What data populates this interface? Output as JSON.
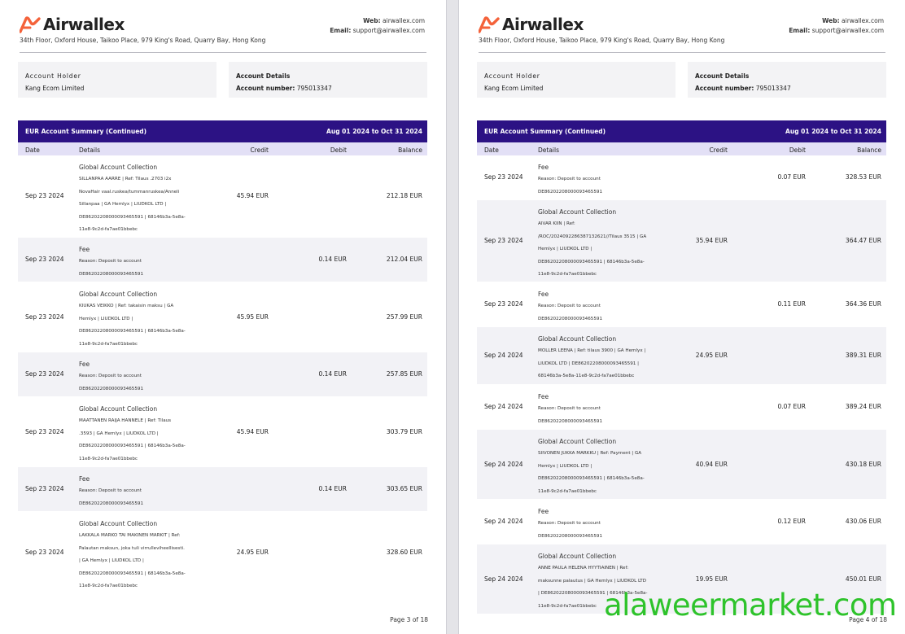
{
  "brand": {
    "name": "Airwallex",
    "address": "34th Floor, Oxford House, Taikoo Place, 979 King's Road, Quarry Bay, Hong Kong",
    "web_label": "Web:",
    "web_value": "airwallex.com",
    "email_label": "Email:",
    "email_value": "support@airwallex.com",
    "accent_color": "#f4623a",
    "header_color": "#2c1284"
  },
  "account": {
    "holder_label": "Account Holder",
    "holder_value": "Kang Ecom Limited",
    "details_label": "Account Details",
    "number_label": "Account number:",
    "number_value": "795013347"
  },
  "summary": {
    "title": "EUR Account Summary (Continued)",
    "period": "Aug 01 2024 to Oct 31 2024",
    "columns": {
      "date": "Date",
      "details": "Details",
      "credit": "Credit",
      "debit": "Debit",
      "balance": "Balance"
    }
  },
  "pages": [
    {
      "page_label": "Page 3 of 18",
      "rows": [
        {
          "date": "Sep 23 2024",
          "title": "Global Account Collection",
          "lines": [
            "SILLANPAA AARRE | Ref: Tilaus .2703 i2x",
            "NovaHair vaal.ruskea/tummanruskea/Anneli",
            "Sillanpaa | GA Hemlyx | LIUDKOL LTD |",
            "DE86202208000093465591 | 68146b3a-5e8a-",
            "11e8-9c2d-fa7ae01bbebc"
          ],
          "credit": "45.94 EUR",
          "debit": "",
          "balance": "212.18 EUR"
        },
        {
          "date": "Sep 23 2024",
          "title": "Fee",
          "lines": [
            "Reason: Deposit to account",
            "DE86202208000093465591"
          ],
          "credit": "",
          "debit": "0.14 EUR",
          "balance": "212.04 EUR"
        },
        {
          "date": "Sep 23 2024",
          "title": "Global Account Collection",
          "lines": [
            "KIUKAS VEIKKO | Ref: takaisin maksu | GA",
            "Hemlyx | LIUDKOL LTD |",
            "DE86202208000093465591 | 68146b3a-5e8a-",
            "11e8-9c2d-fa7ae01bbebc"
          ],
          "credit": "45.95 EUR",
          "debit": "",
          "balance": "257.99 EUR"
        },
        {
          "date": "Sep 23 2024",
          "title": "Fee",
          "lines": [
            "Reason: Deposit to account",
            "DE86202208000093465591"
          ],
          "credit": "",
          "debit": "0.14 EUR",
          "balance": "257.85 EUR"
        },
        {
          "date": "Sep 23 2024",
          "title": "Global Account Collection",
          "lines": [
            "MAATTANEN RAIJA HANNELE | Ref: Tilaus",
            ".3593 | GA Hemlyx | LIUDKOL LTD |",
            "DE86202208000093465591 | 68146b3a-5e8a-",
            "11e8-9c2d-fa7ae01bbebc"
          ],
          "credit": "45.94 EUR",
          "debit": "",
          "balance": "303.79 EUR"
        },
        {
          "date": "Sep 23 2024",
          "title": "Fee",
          "lines": [
            "Reason: Deposit to account",
            "DE86202208000093465591"
          ],
          "credit": "",
          "debit": "0.14 EUR",
          "balance": "303.65 EUR"
        },
        {
          "date": "Sep 23 2024",
          "title": "Global Account Collection",
          "lines": [
            "LAKKALA MARKO TAI MAKINEN MARKIT | Ref:",
            "Palautan maksun, joka tuli virrulleviheellisesti.",
            "| GA Hemlyx | LIUDKOL LTD |",
            "DE86202208000093465591 | 68146b3a-5e8a-",
            "11e8-9c2d-fa7ae01bbebc"
          ],
          "credit": "24.95 EUR",
          "debit": "",
          "balance": "328.60 EUR"
        }
      ]
    },
    {
      "page_label": "Page 4 of 18",
      "rows": [
        {
          "date": "Sep 23 2024",
          "title": "Fee",
          "lines": [
            "Reason: Deposit to account",
            "DE86202208000093465591"
          ],
          "credit": "",
          "debit": "0.07 EUR",
          "balance": "328.53 EUR"
        },
        {
          "date": "Sep 23 2024",
          "title": "Global Account Collection",
          "lines": [
            "AIVAR KIIN | Ref:",
            "/ROC/2024092286387132621//Tilaus 3515 | GA",
            "Hemlyx | LIUDKOL LTD |",
            "DE86202208000093465591 | 68146b3a-5e8a-",
            "11e8-9c2d-fa7ae01bbebc"
          ],
          "credit": "35.94 EUR",
          "debit": "",
          "balance": "364.47 EUR"
        },
        {
          "date": "Sep 23 2024",
          "title": "Fee",
          "lines": [
            "Reason: Deposit to account",
            "DE86202208000093465591"
          ],
          "credit": "",
          "debit": "0.11 EUR",
          "balance": "364.36 EUR"
        },
        {
          "date": "Sep 24 2024",
          "title": "Global Account Collection",
          "lines": [
            "MOLLER LEENA | Ref: tilaus 3900 | GA Hemlyx |",
            "LIUDKOL LTD | DE86202208000093465591 |",
            "68146b3a-5e8a-11e8-9c2d-fa7ae01bbebc"
          ],
          "credit": "24.95 EUR",
          "debit": "",
          "balance": "389.31 EUR"
        },
        {
          "date": "Sep 24 2024",
          "title": "Fee",
          "lines": [
            "Reason: Deposit to account",
            "DE86202208000093465591"
          ],
          "credit": "",
          "debit": "0.07 EUR",
          "balance": "389.24 EUR"
        },
        {
          "date": "Sep 24 2024",
          "title": "Global Account Collection",
          "lines": [
            "SIIVONEN JUKKA MARKKU | Ref: Payment | GA",
            "Hemlyx | LIUDKOL LTD |",
            "DE86202208000093465591 | 68146b3a-5e8a-",
            "11e8-9c2d-fa7ae01bbebc"
          ],
          "credit": "40.94 EUR",
          "debit": "",
          "balance": "430.18 EUR"
        },
        {
          "date": "Sep 24 2024",
          "title": "Fee",
          "lines": [
            "Reason: Deposit to account",
            "DE86202208000093465591"
          ],
          "credit": "",
          "debit": "0.12 EUR",
          "balance": "430.06 EUR"
        },
        {
          "date": "Sep 24 2024",
          "title": "Global Account Collection",
          "lines": [
            "ANNE PAULA HELENA HYYTIAINEN | Ref:",
            "maksunne palautus | GA Hemlyx | LIUDKOL LTD",
            "| DE86202208000093465591 | 68146b3a-5e8a-",
            "11e8-9c2d-fa7ae01bbebc"
          ],
          "credit": "19.95 EUR",
          "debit": "",
          "balance": "450.01 EUR"
        }
      ]
    }
  ],
  "watermark": "alaweermarket.com"
}
